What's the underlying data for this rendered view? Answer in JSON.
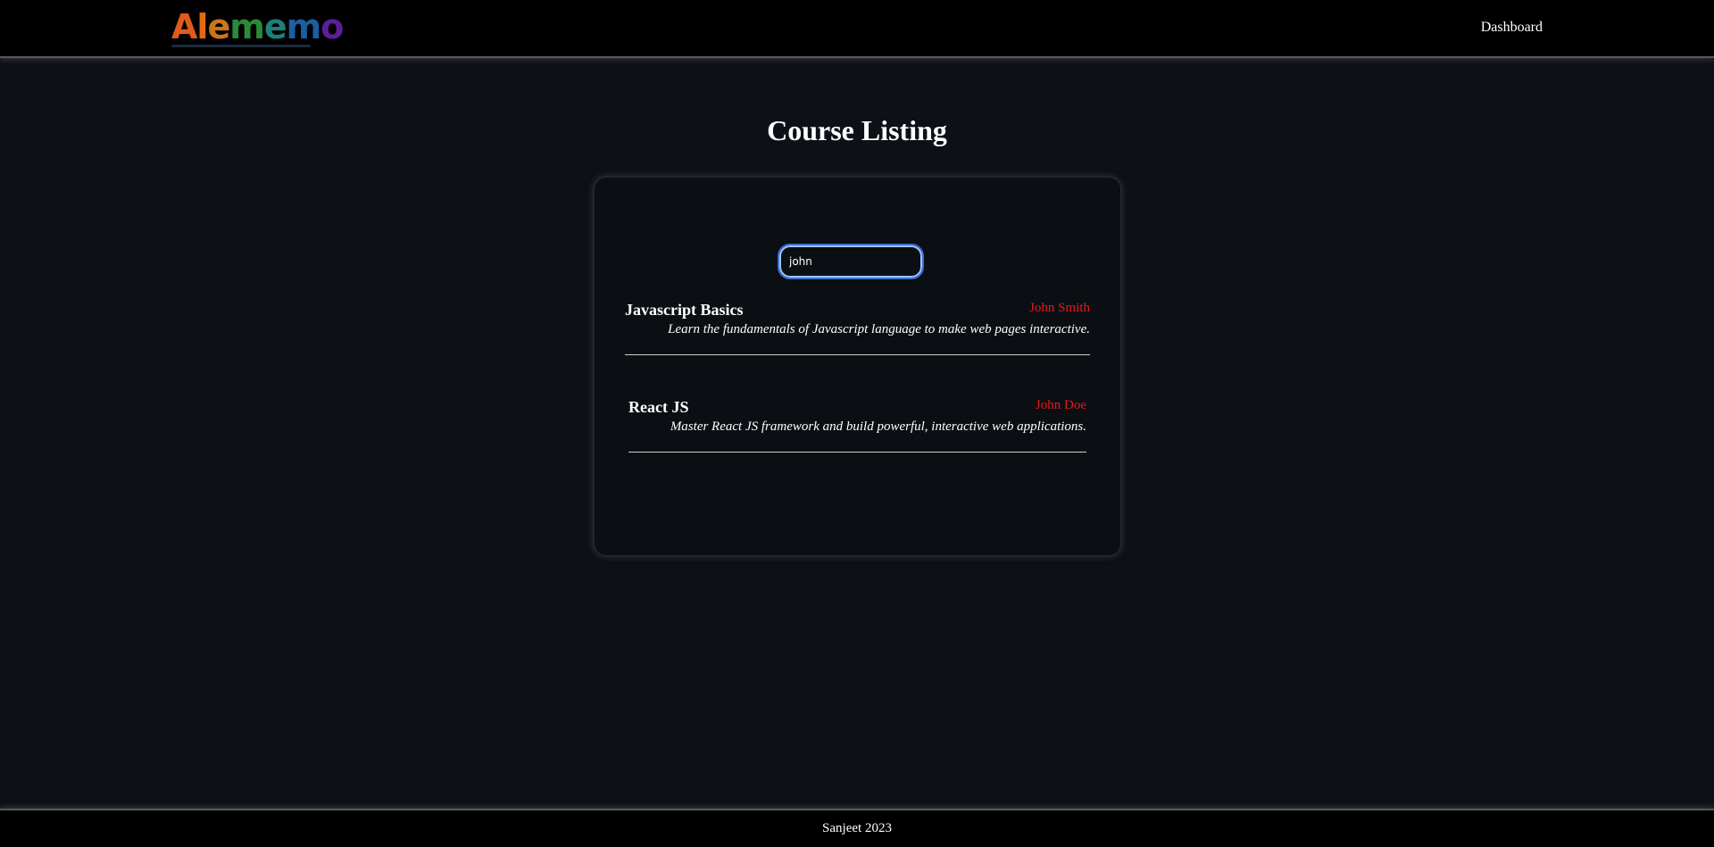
{
  "header": {
    "logo_text": "Alememo",
    "logo_letters": [
      {
        "ch": "A",
        "color": "#e05a1a"
      },
      {
        "ch": "l",
        "color": "#e06a12"
      },
      {
        "ch": "e",
        "color": "#c9761a"
      },
      {
        "ch": "m",
        "color": "#2a8a3a"
      },
      {
        "ch": "e",
        "color": "#1f7f7a"
      },
      {
        "ch": "m",
        "color": "#1a5fa0"
      },
      {
        "ch": "o",
        "color": "#5b1f9a"
      }
    ],
    "nav_links": [
      {
        "label": "Dashboard"
      }
    ]
  },
  "main": {
    "title": "Course Listing",
    "search": {
      "value": "john",
      "placeholder": ""
    },
    "courses": [
      {
        "title": "Javascript Basics",
        "instructor": "John Smith",
        "description": "Learn the fundamentals of Javascript language to make web pages interactive."
      },
      {
        "title": "React JS",
        "instructor": "John Doe",
        "description": "Master React JS framework and build powerful, interactive web applications."
      }
    ]
  },
  "footer": {
    "text": "Sanjeet 2023"
  },
  "colors": {
    "background": "#0d1117",
    "navbar": "#000000",
    "instructor": "#e8191b",
    "search_focus": "#3b6fd8"
  }
}
